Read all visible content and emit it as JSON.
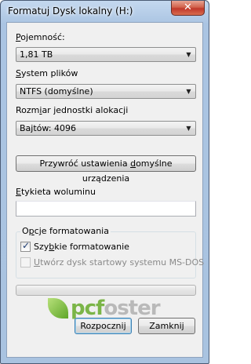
{
  "window": {
    "title": "Formatuj Dysk lokalny (H:)",
    "close_glyph": "✕"
  },
  "capacity": {
    "label": "Pojemność:",
    "value": "1,81 TB"
  },
  "filesystem": {
    "label": "System plików",
    "value": "NTFS (domyślne)"
  },
  "allocation": {
    "label": "Rozmiar jednostki alokacji",
    "value": "Bajtów: 4096"
  },
  "restore_button": "Przywróć ustawienia domyślne urządzenia",
  "volume_label": {
    "label": "Etykieta woluminu",
    "value": ""
  },
  "format_options": {
    "title": "Opcje formatowania",
    "quick_format": {
      "label": "Szybkie formatowanie",
      "checked": true,
      "enabled": true
    },
    "msdos_startup": {
      "label": "Utwórz dysk startowy systemu MS-DOS",
      "checked": false,
      "enabled": false
    }
  },
  "progress": {
    "value": 0
  },
  "watermark": {
    "prefix": "pcf",
    "suffix": "oster"
  },
  "buttons": {
    "start": "Rozpocznij",
    "close": "Zamknij"
  },
  "icons": {
    "dropdown": "chevron-down-icon",
    "check": "checkmark-icon",
    "close": "close-icon"
  }
}
